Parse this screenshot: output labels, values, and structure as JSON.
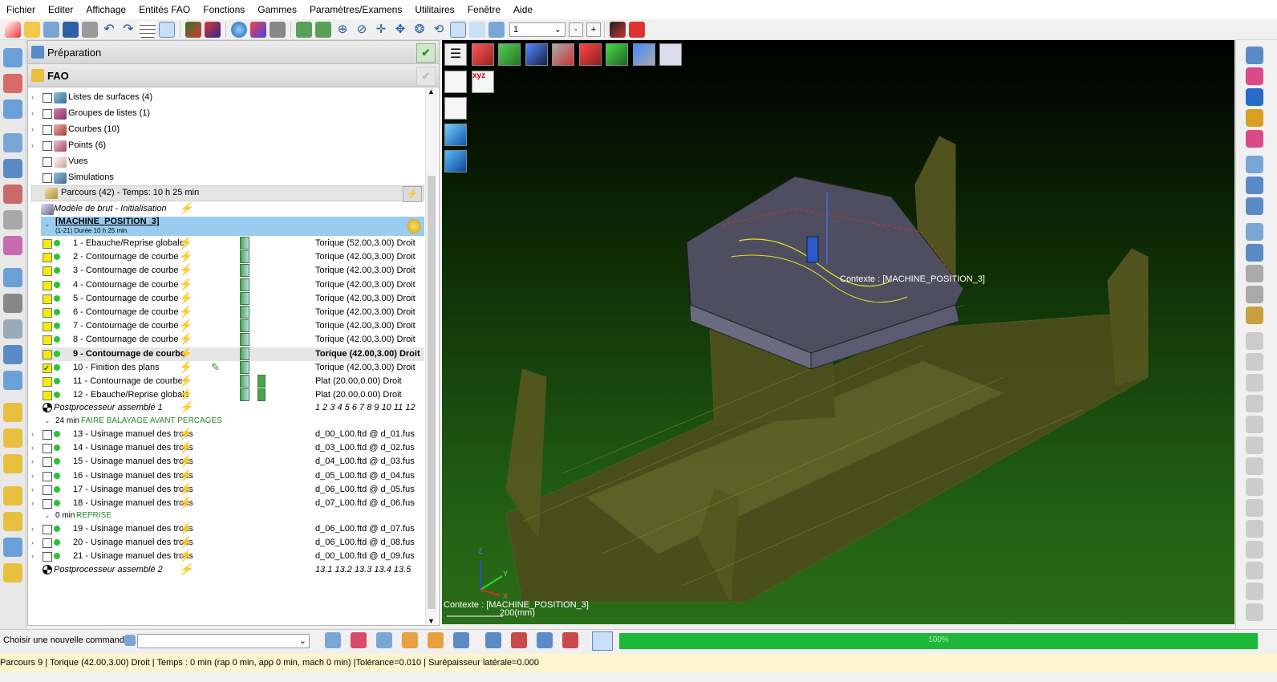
{
  "menu": [
    "Fichier",
    "Editer",
    "Affichage",
    "Entités FAO",
    "Fonctions",
    "Gammes",
    "Paramètres/Examens",
    "Utilitaires",
    "Fenêtre",
    "Aide"
  ],
  "toolbar": {
    "view_number": "1",
    "minus_label": "-",
    "plus_label": "+"
  },
  "panel": {
    "preparation_title": "Préparation",
    "fao_title": "FAO",
    "tree_items": [
      {
        "label": "Listes de surfaces (4)"
      },
      {
        "label": "Groupes de listes (1)"
      },
      {
        "label": "Courbes (10)"
      },
      {
        "label": "Points (6)"
      },
      {
        "label": "Vues"
      },
      {
        "label": "Simulations"
      }
    ],
    "parcours_header": "Parcours (42) - Temps: 10 h 25 min",
    "brut_label": "Modèle de brut - Initialisation",
    "machine_title": "[MACHINE_POSITION_3]",
    "machine_sub": "(1-21) Durée 10 h 25 min",
    "ops": [
      {
        "label": "1 - Ebauche/Reprise globale",
        "tool": "Torique (52.00,3.00) Droit"
      },
      {
        "label": "2 - Contournage de courbe",
        "tool": "Torique (42.00,3.00) Droit"
      },
      {
        "label": "3 - Contournage de courbe",
        "tool": "Torique (42.00,3.00) Droit"
      },
      {
        "label": "4 - Contournage de courbe",
        "tool": "Torique (42.00,3.00) Droit"
      },
      {
        "label": "5 - Contournage de courbe",
        "tool": "Torique (42.00,3.00) Droit"
      },
      {
        "label": "6 - Contournage de courbe",
        "tool": "Torique (42.00,3.00) Droit"
      },
      {
        "label": "7 - Contournage de courbe",
        "tool": "Torique (42.00,3.00) Droit"
      },
      {
        "label": "8 - Contournage de courbe",
        "tool": "Torique (42.00,3.00) Droit"
      },
      {
        "label": "9 - Contournage de courbe",
        "tool": "Torique (42.00,3.00) Droit"
      },
      {
        "label": "10 - Finition des plans",
        "tool": "Torique (42.00,3.00) Droit"
      },
      {
        "label": "11 - Contournage de courbe",
        "tool": "Plat (20.00,0.00) Droit"
      },
      {
        "label": "12 - Ebauche/Reprise globale",
        "tool": "Plat (20.00,0.00) Droit"
      }
    ],
    "post1_label": "Postprocesseur assemblé 1",
    "post1_value": "1 2 3 4 5 6 7 8 9 10 11 12",
    "group1_time": "24 min -",
    "group1_name": "FAIRE BALAYAGE AVANT PERCAGES",
    "group1_ops": [
      {
        "label": "13 - Usinage manuel des trous",
        "file": "d_00_L00.ftd @ d_01.fus"
      },
      {
        "label": "14 - Usinage manuel des trous",
        "file": "d_03_L00.ftd @ d_02.fus"
      },
      {
        "label": "15 - Usinage manuel des trous",
        "file": "d_04_L00.ftd @ d_03.fus"
      },
      {
        "label": "16 - Usinage manuel des trous",
        "file": "d_05_L00.ftd @ d_04.fus"
      },
      {
        "label": "17 - Usinage manuel des trous",
        "file": "d_06_L00.ftd @ d_05.fus"
      },
      {
        "label": "18 - Usinage manuel des trous",
        "file": "d_07_L00.ftd @ d_06.fus"
      }
    ],
    "group2_time": "0 min -",
    "group2_name": "REPRISE",
    "group2_ops": [
      {
        "label": "19 - Usinage manuel des trous",
        "file": "d_06_L00.ftd @ d_07.fus"
      },
      {
        "label": "20 - Usinage manuel des trous",
        "file": "d_06_L00.ftd @ d_08.fus"
      },
      {
        "label": "21 - Usinage manuel des trous",
        "file": "d_00_L00.ftd @ d_09.fus"
      }
    ],
    "post2_label": "Postprocesseur assemblé 2",
    "post2_value": "13.1 13.2 13.3 13.4 13.5"
  },
  "viewport": {
    "context_label": "Contexte : [MACHINE_POSITION_3]",
    "context_bottom": "Contexte : [MACHINE_POSITION_3]",
    "scale_label": "200(mm)",
    "axis_z": "Z",
    "axis_x": "X",
    "axis_y": "Y"
  },
  "cmdbar": {
    "prompt": "Choisir une nouvelle commande...",
    "progress_text": "100%"
  },
  "status": "Parcours 9 | Torique (42.00,3.00) Droit | Temps : 0 min (rap 0 min, app 0 min, mach 0 min) |Tolérance=0.010 | Surépaisseur latérale=0.000",
  "colors": {
    "machine_highlight": "#99ccf0",
    "progress": "#1db83a",
    "ops_green": "#2cc23a"
  }
}
